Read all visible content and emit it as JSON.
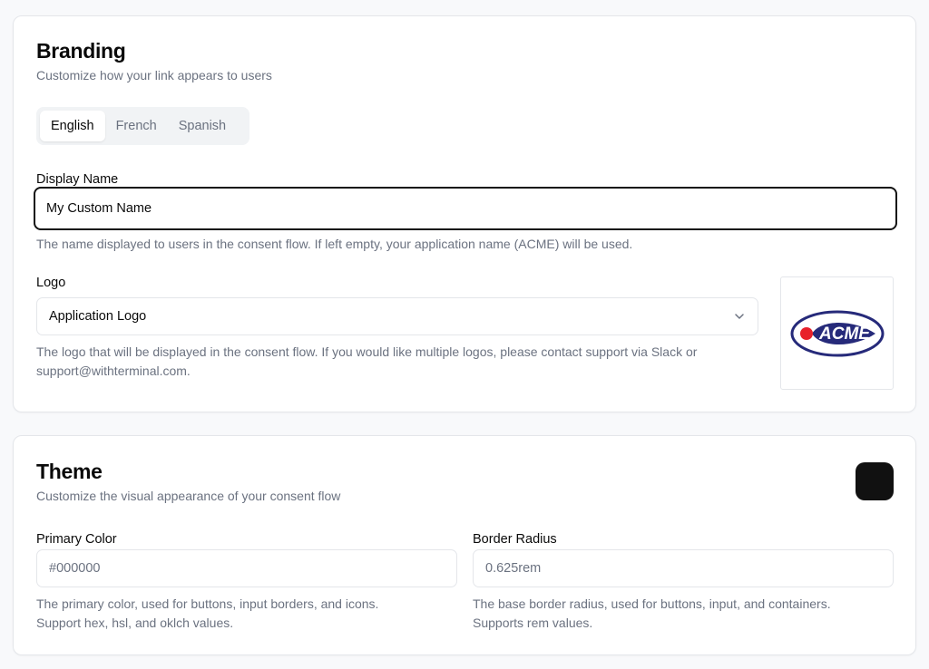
{
  "branding": {
    "title": "Branding",
    "subtitle": "Customize how your link appears to users",
    "languages": [
      "English",
      "French",
      "Spanish"
    ],
    "active_language": "English",
    "display_name": {
      "label": "Display Name",
      "value": "My Custom Name",
      "help": "The name displayed to users in the consent flow. If left empty, your application name (ACME) will be used."
    },
    "logo": {
      "label": "Logo",
      "selected": "Application Logo",
      "help_line1": "The logo that will be displayed in the consent flow. If you would like multiple logos, please contact support via Slack or",
      "help_line2": "support@withterminal.com.",
      "preview_text": "ACME"
    }
  },
  "theme": {
    "title": "Theme",
    "subtitle": "Customize the visual appearance of your consent flow",
    "swatch_color": "#111111",
    "primary_color": {
      "label": "Primary Color",
      "value": "#000000",
      "help_line1": "The primary color, used for buttons, input borders, and icons.",
      "help_line2": "Support hex, hsl, and oklch values."
    },
    "border_radius": {
      "label": "Border Radius",
      "value": "0.625rem",
      "help_line1": "The base border radius, used for buttons, input, and containers.",
      "help_line2": "Supports rem values."
    }
  },
  "colors": {
    "logo_navy": "#262a7a",
    "logo_red": "#e8202a"
  },
  "icons": {
    "select_chevron": "chevron-down-icon"
  }
}
